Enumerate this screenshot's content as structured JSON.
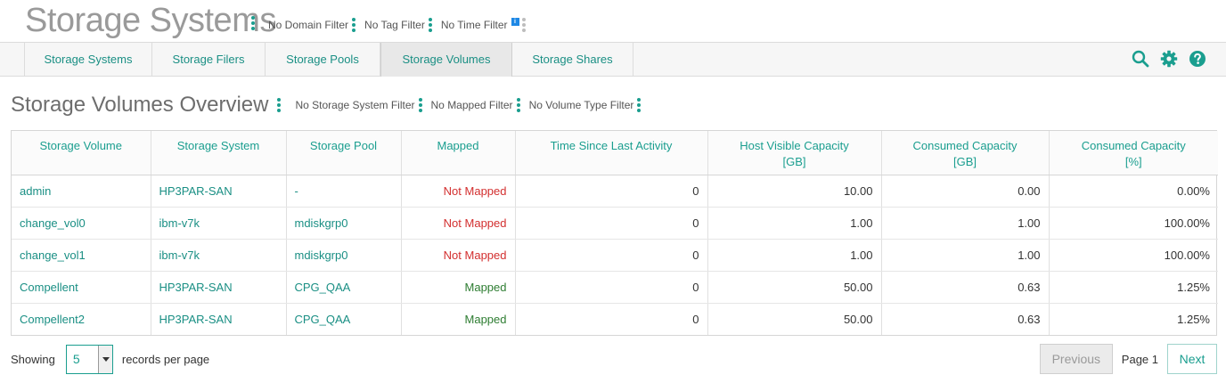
{
  "header": {
    "title": "Storage Systems",
    "filters": [
      "No Domain Filter",
      "No Tag Filter",
      "No Time Filter"
    ],
    "info_badge": "i"
  },
  "tabs": [
    {
      "label": "Storage Systems",
      "active": false
    },
    {
      "label": "Storage Filers",
      "active": false
    },
    {
      "label": "Storage Pools",
      "active": false
    },
    {
      "label": "Storage Volumes",
      "active": true
    },
    {
      "label": "Storage Shares",
      "active": false
    }
  ],
  "toolbar": {
    "icons": [
      "search-icon",
      "gear-icon",
      "help-icon"
    ]
  },
  "section": {
    "title": "Storage Volumes Overview",
    "filters": [
      "No Storage System Filter",
      "No Mapped Filter",
      "No Volume Type Filter"
    ]
  },
  "table": {
    "columns": [
      {
        "label": "Storage Volume",
        "unit": ""
      },
      {
        "label": "Storage System",
        "unit": ""
      },
      {
        "label": "Storage Pool",
        "unit": ""
      },
      {
        "label": "Mapped",
        "unit": ""
      },
      {
        "label": "Time Since Last Activity",
        "unit": ""
      },
      {
        "label": "Host Visible Capacity",
        "unit": "[GB]"
      },
      {
        "label": "Consumed Capacity",
        "unit": "[GB]"
      },
      {
        "label": "Consumed Capacity",
        "unit": "[%]"
      }
    ],
    "rows": [
      {
        "volume": "admin",
        "system": "HP3PAR-SAN",
        "pool": "-",
        "mapped": "Not Mapped",
        "last_activity": "0",
        "host_visible_gb": "10.00",
        "consumed_gb": "0.00",
        "consumed_pct": "0.00%"
      },
      {
        "volume": "change_vol0",
        "system": "ibm-v7k",
        "pool": "mdiskgrp0",
        "mapped": "Not Mapped",
        "last_activity": "0",
        "host_visible_gb": "1.00",
        "consumed_gb": "1.00",
        "consumed_pct": "100.00%"
      },
      {
        "volume": "change_vol1",
        "system": "ibm-v7k",
        "pool": "mdiskgrp0",
        "mapped": "Not Mapped",
        "last_activity": "0",
        "host_visible_gb": "1.00",
        "consumed_gb": "1.00",
        "consumed_pct": "100.00%"
      },
      {
        "volume": "Compellent",
        "system": "HP3PAR-SAN",
        "pool": "CPG_QAA",
        "mapped": "Mapped",
        "last_activity": "0",
        "host_visible_gb": "50.00",
        "consumed_gb": "0.63",
        "consumed_pct": "1.25%"
      },
      {
        "volume": "Compellent2",
        "system": "HP3PAR-SAN",
        "pool": "CPG_QAA",
        "mapped": "Mapped",
        "last_activity": "0",
        "host_visible_gb": "50.00",
        "consumed_gb": "0.63",
        "consumed_pct": "1.25%"
      }
    ]
  },
  "footer": {
    "showing_label": "Showing",
    "per_page_value": "5",
    "per_page_label": "records per page",
    "prev_label": "Previous",
    "page_label": "Page 1",
    "next_label": "Next"
  },
  "colors": {
    "accent": "#1a9e8f",
    "not_mapped": "#d32f2f",
    "mapped": "#2e7d32",
    "title_grey": "#9a9a9a"
  }
}
